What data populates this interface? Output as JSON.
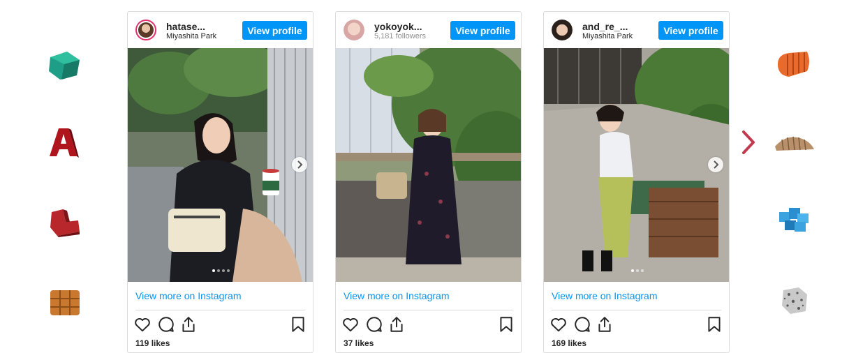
{
  "colors": {
    "accent": "#0095f6",
    "text": "#262626",
    "muted": "#8e8e8e",
    "border": "#dbdbdb",
    "next_arrow": "#c13a4d"
  },
  "decorations": {
    "left": [
      "teal-cube-icon",
      "red-letter-a-icon",
      "red-block-icon",
      "orange-grid-cube-icon"
    ],
    "right": [
      "orange-ribbed-shape-icon",
      "tan-ribbed-shape-icon",
      "blue-block-cluster-icon",
      "grey-rock-icon"
    ]
  },
  "posts": [
    {
      "username": "hatase...",
      "subtitle": "Miyashita Park",
      "view_profile": "View profile",
      "view_more": "View more on Instagram",
      "likes": "119 likes",
      "carousel_count": 4,
      "carousel_active": 1
    },
    {
      "username": "yokoyok...",
      "subtitle": "5,181 followers",
      "view_profile": "View profile",
      "view_more": "View more on Instagram",
      "likes": "37 likes",
      "carousel_count": 1,
      "carousel_active": 1
    },
    {
      "username": "and_re_...",
      "subtitle": "Miyashita Park",
      "view_profile": "View profile",
      "view_more": "View more on Instagram",
      "likes": "169 likes",
      "carousel_count": 3,
      "carousel_active": 1
    }
  ],
  "icons": {
    "like": "heart-icon",
    "comment": "comment-icon",
    "share": "share-icon",
    "save": "bookmark-icon",
    "next": "chevron-right-icon"
  }
}
